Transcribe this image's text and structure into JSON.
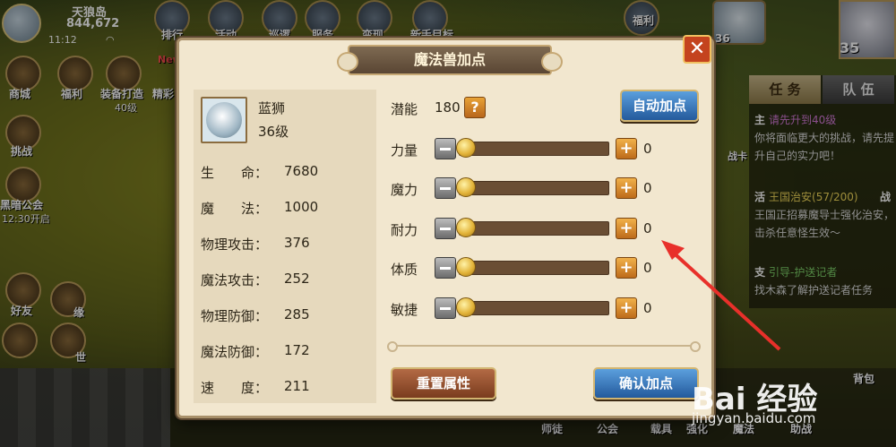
{
  "player": {
    "name": "天狼岛",
    "power": "844,672",
    "time": "11:12"
  },
  "top_icons": [
    "排行",
    "活动",
    "巡逻",
    "服务",
    "变现",
    "新手目标",
    "福利"
  ],
  "side_icons": [
    {
      "label": "商城"
    },
    {
      "label": "福利"
    },
    {
      "label": "装备打造"
    },
    {
      "label": "精彩"
    },
    {
      "label": "挑战"
    },
    {
      "label": "黑暗公会"
    },
    {
      "label": "好友"
    },
    {
      "label": "缘"
    },
    {
      "label": "世"
    }
  ],
  "side_sub": {
    "equip_level": "40级",
    "guild_time": "12:30开启",
    "new_badge": "New"
  },
  "right_top": {
    "level": "35",
    "beast_level": "36"
  },
  "task_panel": {
    "tabs": [
      "任 务",
      "队 伍"
    ],
    "entries": [
      {
        "tag": "主",
        "title": "请先升到40级",
        "desc": "你将面临更大的挑战，请先提升自己的实力吧！"
      },
      {
        "tag": "活",
        "title": "王国治安(57/200)",
        "extra": "战",
        "desc": "王国正招募魔导士强化治安，击杀任意怪生效～"
      },
      {
        "tag": "支",
        "title": "引导-护送记者",
        "desc": "找木森了解护送记者任务"
      }
    ],
    "side_label": "战卡"
  },
  "bottom_labels": [
    "师徒",
    "公会",
    "载具",
    "强化",
    "魔法",
    "助战",
    "背包"
  ],
  "dialog": {
    "title": "魔法兽加点",
    "close_glyph": "✕",
    "beast": {
      "name": "蓝狮",
      "level": "36级"
    },
    "stats": [
      {
        "label": "生　　命：",
        "value": "7680"
      },
      {
        "label": "魔　　法：",
        "value": "1000"
      },
      {
        "label": "物理攻击：",
        "value": "376"
      },
      {
        "label": "魔法攻击：",
        "value": "252"
      },
      {
        "label": "物理防御：",
        "value": "285"
      },
      {
        "label": "魔法防御：",
        "value": "172"
      },
      {
        "label": "速　　度：",
        "value": "211"
      }
    ],
    "potential": {
      "label": "潜能",
      "value": "180",
      "help": "?"
    },
    "auto_button": "自动加点",
    "attributes": [
      {
        "label": "力量",
        "value": "0"
      },
      {
        "label": "魔力",
        "value": "0"
      },
      {
        "label": "耐力",
        "value": "0"
      },
      {
        "label": "体质",
        "value": "0"
      },
      {
        "label": "敏捷",
        "value": "0"
      }
    ],
    "plus_glyph": "+",
    "reset_button": "重置属性",
    "confirm_button": "确认加点"
  },
  "watermark": {
    "brand": "Bai 经验",
    "url": "jingyan.baidu.com"
  }
}
